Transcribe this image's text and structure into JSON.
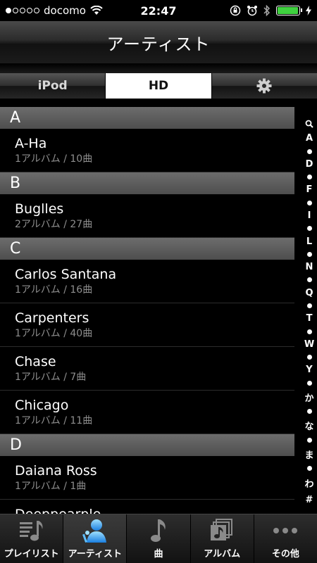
{
  "status": {
    "carrier": "docomo",
    "time": "22:47",
    "battery_level": 0.95,
    "battery_color": "#3fd13f"
  },
  "header": {
    "title": "アーティスト"
  },
  "segments": [
    {
      "label": "iPod",
      "active": false
    },
    {
      "label": "HD",
      "active": true
    },
    {
      "label": "",
      "icon": "gear-icon",
      "active": false
    }
  ],
  "sections": [
    {
      "letter": "A",
      "rows": [
        {
          "name": "A-Ha",
          "detail": "1アルバム / 10曲"
        }
      ]
    },
    {
      "letter": "B",
      "rows": [
        {
          "name": "Buglles",
          "detail": "2アルバム / 27曲"
        }
      ]
    },
    {
      "letter": "C",
      "rows": [
        {
          "name": "Carlos Santana",
          "detail": "1アルバム / 16曲"
        },
        {
          "name": "Carpenters",
          "detail": "1アルバム / 40曲"
        },
        {
          "name": "Chase",
          "detail": "1アルバム / 7曲"
        },
        {
          "name": "Chicago",
          "detail": "1アルバム / 11曲"
        }
      ]
    },
    {
      "letter": "D",
      "rows": [
        {
          "name": "Daiana Ross",
          "detail": "1アルバム / 1曲"
        },
        {
          "name": "Deeppearple",
          "detail": ""
        }
      ]
    }
  ],
  "index": [
    "search",
    "A",
    "•",
    "D",
    "•",
    "F",
    "•",
    "I",
    "•",
    "L",
    "•",
    "N",
    "•",
    "Q",
    "•",
    "T",
    "•",
    "W",
    "•",
    "Y",
    "•",
    "か",
    "•",
    "な",
    "•",
    "ま",
    "•",
    "わ",
    "#"
  ],
  "tabs": [
    {
      "label": "プレイリスト",
      "icon": "playlist-icon",
      "active": false
    },
    {
      "label": "アーティスト",
      "icon": "artist-icon",
      "active": true
    },
    {
      "label": "曲",
      "icon": "music-note-icon",
      "active": false
    },
    {
      "label": "アルバム",
      "icon": "album-icon",
      "active": false
    },
    {
      "label": "その他",
      "icon": "more-icon",
      "active": false
    }
  ]
}
